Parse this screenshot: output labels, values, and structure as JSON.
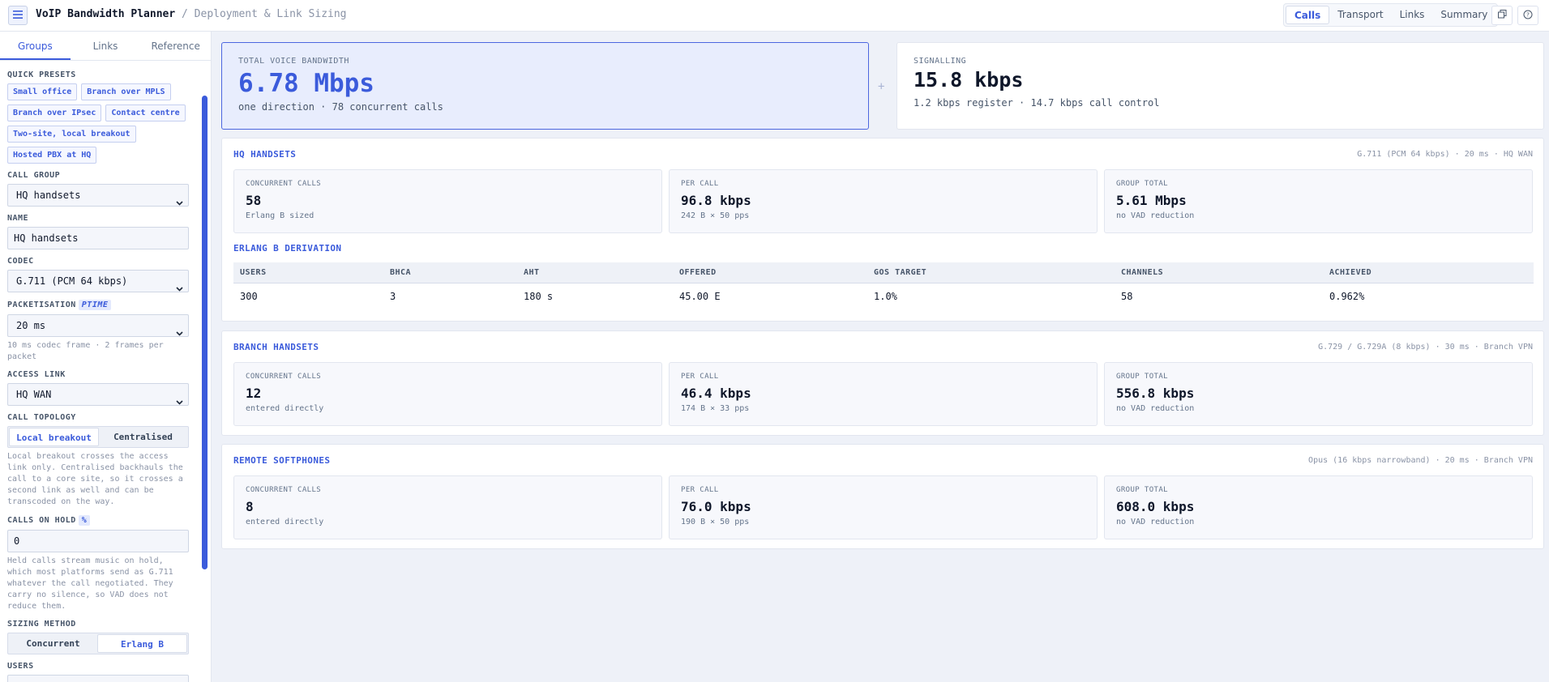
{
  "header": {
    "title": "VoIP Bandwidth Planner",
    "subtitle": "/ Deployment & Link Sizing",
    "tabs": [
      "Calls",
      "Transport",
      "Links",
      "Summary"
    ],
    "active_tab": "Calls"
  },
  "sidebar": {
    "tabs": [
      "Groups",
      "Links",
      "Reference"
    ],
    "active_tab": "Groups",
    "quick_presets_label": "QUICK PRESETS",
    "presets": [
      "Small office",
      "Branch over MPLS",
      "Branch over IPsec",
      "Contact centre",
      "Two-site, local breakout",
      "Hosted PBX at HQ"
    ],
    "call_group_label": "CALL GROUP",
    "call_group_value": "HQ handsets",
    "name_label": "NAME",
    "name_value": "HQ handsets",
    "codec_label": "CODEC",
    "codec_value": "G.711 (PCM 64 kbps)",
    "packetisation_label": "PACKETISATION",
    "packetisation_badge": "PTIME",
    "packetisation_value": "20 ms",
    "packetisation_hint": "10 ms codec frame · 2 frames per packet",
    "access_link_label": "ACCESS LINK",
    "access_link_value": "HQ WAN",
    "topology_label": "CALL TOPOLOGY",
    "topology_options": [
      "Local breakout",
      "Centralised"
    ],
    "topology_active": "Local breakout",
    "topology_hint": "Local breakout crosses the access link only. Centralised backhauls the call to a core site, so it crosses a second link as well and can be transcoded on the way.",
    "hold_label": "CALLS ON HOLD",
    "hold_badge": "%",
    "hold_value": "0",
    "hold_hint": "Held calls stream music on hold, which most platforms send as G.711 whatever the call negotiated. They carry no silence, so VAD does not reduce them.",
    "sizing_label": "SIZING METHOD",
    "sizing_options": [
      "Concurrent",
      "Erlang B"
    ],
    "sizing_active": "Erlang B",
    "users_label": "USERS",
    "users_value": "300"
  },
  "hero": {
    "total_label": "TOTAL VOICE BANDWIDTH",
    "total_value": "6.78 Mbps",
    "total_sub": "one direction · 78 concurrent calls",
    "plus": "+",
    "signalling_label": "SIGNALLING",
    "signalling_value": "15.8 kbps",
    "signalling_sub": "1.2 kbps register · 14.7 kbps call control"
  },
  "groups": [
    {
      "title": "HQ HANDSETS",
      "meta": "G.711 (PCM 64 kbps) · 20 ms · HQ WAN",
      "concurrent_label": "CONCURRENT CALLS",
      "concurrent_value": "58",
      "concurrent_sub": "Erlang B sized",
      "per_call_label": "PER CALL",
      "per_call_value": "96.8 kbps",
      "per_call_sub": "242 B × 50 pps",
      "total_label": "GROUP TOTAL",
      "total_value": "5.61 Mbps",
      "total_sub": "no VAD reduction"
    },
    {
      "title": "BRANCH HANDSETS",
      "meta": "G.729 / G.729A (8 kbps) · 30 ms · Branch VPN",
      "concurrent_label": "CONCURRENT CALLS",
      "concurrent_value": "12",
      "concurrent_sub": "entered directly",
      "per_call_label": "PER CALL",
      "per_call_value": "46.4 kbps",
      "per_call_sub": "174 B × 33 pps",
      "total_label": "GROUP TOTAL",
      "total_value": "556.8 kbps",
      "total_sub": "no VAD reduction"
    },
    {
      "title": "REMOTE SOFTPHONES",
      "meta": "Opus (16 kbps narrowband) · 20 ms · Branch VPN",
      "concurrent_label": "CONCURRENT CALLS",
      "concurrent_value": "8",
      "concurrent_sub": "entered directly",
      "per_call_label": "PER CALL",
      "per_call_value": "76.0 kbps",
      "per_call_sub": "190 B × 50 pps",
      "total_label": "GROUP TOTAL",
      "total_value": "608.0 kbps",
      "total_sub": "no VAD reduction"
    }
  ],
  "erlang": {
    "title": "ERLANG B DERIVATION",
    "headers": [
      "USERS",
      "BHCA",
      "AHT",
      "OFFERED",
      "GOS TARGET",
      "CHANNELS",
      "ACHIEVED"
    ],
    "row": [
      "300",
      "3",
      "180 s",
      "45.00 E",
      "1.0%",
      "58",
      "0.962%"
    ]
  },
  "colors": {
    "accent": "#3b5bdb",
    "background": "#eef1f8"
  }
}
